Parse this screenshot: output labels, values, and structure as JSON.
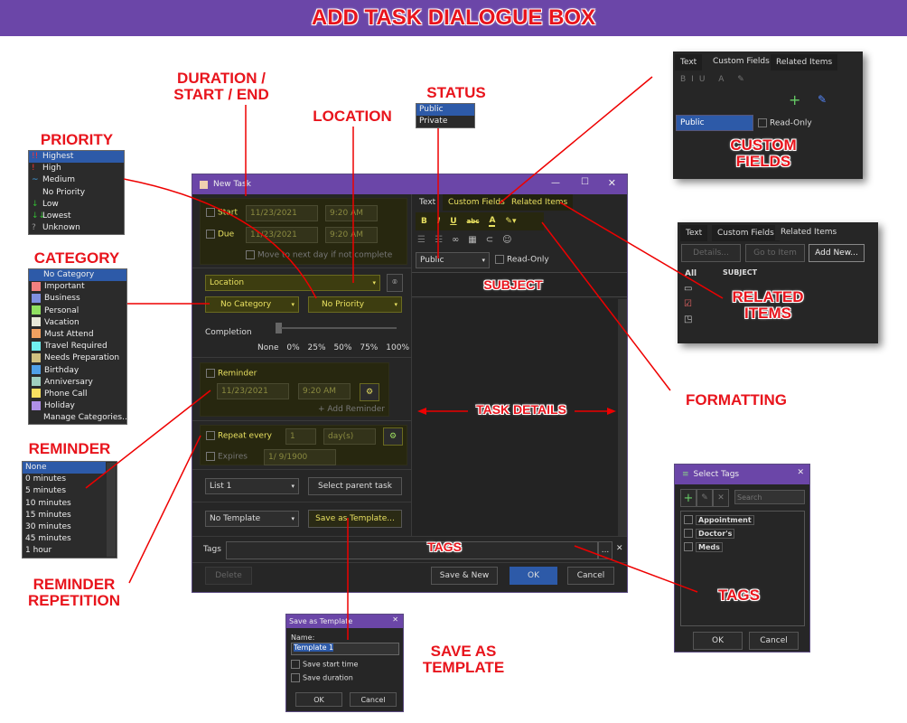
{
  "banner": {
    "title": "ADD TASK DIALOGUE BOX"
  },
  "annotations": {
    "duration": "DURATION /",
    "duration2": "START / END",
    "location": "LOCATION",
    "status": "STATUS",
    "priority": "PRIORITY",
    "category": "CATEGORY",
    "reminder": "REMINDER",
    "repetition": "REMINDER",
    "repetition2": "REPETITION",
    "subject": "SUBJECT",
    "task_details": "TASK DETAILS",
    "tags": "TAGS",
    "formatting": "FORMATTING",
    "custom_fields": "CUSTOM",
    "custom_fields2": "FIELDS",
    "related_items": "RELATED",
    "related_items2": "ITEMS",
    "tags2": "TAGS",
    "save_template": "SAVE AS",
    "save_template2": "TEMPLATE"
  },
  "colors": {
    "accent": "#6b46a8",
    "selection": "#2d5aa8",
    "annotation": "#e8141c"
  },
  "dialog": {
    "title": "New Task",
    "start_label": "Start",
    "due_label": "Due",
    "start_date": "11/23/2021",
    "start_time": "9:20 AM",
    "due_date": "11/23/2021",
    "due_time": "9:20 AM",
    "move_next_day": "Move to next day if not complete",
    "location_placeholder": "Location",
    "category": "No Category",
    "priority": "No Priority",
    "completion_label": "Completion",
    "completion_ticks": [
      "None",
      "0%",
      "25%",
      "50%",
      "75%",
      "100%"
    ],
    "completion_value": "None",
    "reminder_label": "Reminder",
    "reminder_date": "11/23/2021",
    "reminder_time": "9:20 AM",
    "add_reminder": "+ Add Reminder",
    "repeat_label": "Repeat every",
    "repeat_value": "1",
    "repeat_unit": "day(s)",
    "expires_label": "Expires",
    "expires_date": "1/ 9/1900",
    "list": "List 1",
    "select_parent": "Select parent task",
    "template": "No Template",
    "save_template": "Save as Template...",
    "tags_label": "Tags",
    "tags_browse": "...",
    "delete": "Delete",
    "save_new": "Save & New",
    "ok": "OK",
    "cancel": "Cancel",
    "tabs": [
      "Text",
      "Custom Fields",
      "Related Items"
    ],
    "format_buttons": [
      "B",
      "I",
      "U",
      "abc",
      "A"
    ],
    "status": "Public",
    "read_only": "Read-Only"
  },
  "status_popup": {
    "options": [
      "Public",
      "Private"
    ],
    "selected": "Public"
  },
  "priority_popup": {
    "options": [
      {
        "icon": "!!",
        "label": "Highest"
      },
      {
        "icon": "!",
        "label": "High"
      },
      {
        "icon": "~",
        "label": "Medium"
      },
      {
        "icon": "",
        "label": "No Priority"
      },
      {
        "icon": "↓",
        "label": "Low"
      },
      {
        "icon": "↓↓",
        "label": "Lowest"
      },
      {
        "icon": "?",
        "label": "Unknown"
      }
    ],
    "selected": "Highest"
  },
  "category_popup": {
    "options": [
      {
        "label": "No Category",
        "color": ""
      },
      {
        "label": "Important",
        "color": "#f08080"
      },
      {
        "label": "Business",
        "color": "#8090e0"
      },
      {
        "label": "Personal",
        "color": "#90e060"
      },
      {
        "label": "Vacation",
        "color": "#e8e8d8"
      },
      {
        "label": "Must Attend",
        "color": "#f0a060"
      },
      {
        "label": "Travel Required",
        "color": "#70f0f0"
      },
      {
        "label": "Needs Preparation",
        "color": "#d0c080"
      },
      {
        "label": "Birthday",
        "color": "#50a0e8"
      },
      {
        "label": "Anniversary",
        "color": "#a0d0c0"
      },
      {
        "label": "Phone Call",
        "color": "#f8e060"
      },
      {
        "label": "Holiday",
        "color": "#b090e8"
      },
      {
        "label": "Manage Categories...",
        "color": ""
      }
    ],
    "selected": "No Category"
  },
  "reminder_popup": {
    "options": [
      "None",
      "0 minutes",
      "5 minutes",
      "10 minutes",
      "15 minutes",
      "30 minutes",
      "45 minutes",
      "1 hour"
    ],
    "selected": "None"
  },
  "custom_fields_shot": {
    "tabs": [
      "Text",
      "Custom Fields",
      "Related Items"
    ],
    "status": "Public",
    "read_only": "Read-Only"
  },
  "related_items_shot": {
    "tabs": [
      "Text",
      "Custom Fields",
      "Related Items"
    ],
    "buttons": [
      "Details...",
      "Go to Item",
      "Add New..."
    ],
    "filter": "All",
    "column": "SUBJECT"
  },
  "select_tags": {
    "title": "Select Tags",
    "search_placeholder": "Search",
    "tags": [
      "Appointment",
      "Doctor's",
      "Meds"
    ],
    "ok": "OK",
    "cancel": "Cancel"
  },
  "save_template_dialog": {
    "title": "Save as Template",
    "name_label": "Name:",
    "name_value": "Template 1",
    "save_start": "Save start time",
    "save_duration": "Save duration",
    "ok": "OK",
    "cancel": "Cancel"
  }
}
